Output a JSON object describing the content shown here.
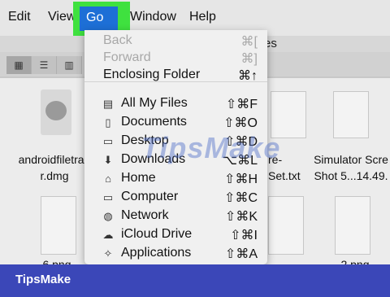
{
  "menubar": {
    "items": [
      "Edit",
      "View",
      "Go",
      "Window",
      "Help"
    ]
  },
  "window": {
    "title_fragment": "es"
  },
  "toolbar": {
    "view_buttons": [
      "icon-view-icon",
      "list-view-icon",
      "column-view-icon"
    ]
  },
  "files": [
    {
      "label_line1": "androidfiletran",
      "label_line2": "r.dmg"
    },
    {
      "label_line1": "re-",
      "label_line2": "Set.txt"
    },
    {
      "label_line1": "Simulator Scre",
      "label_line2": "Shot 5...14.49."
    },
    {
      "label_line1": "6.png",
      "label_line2": ""
    },
    {
      "label_line1": "2.png",
      "label_line2": ""
    }
  ],
  "go_menu": {
    "top_items": [
      {
        "label": "Back",
        "shortcut": "⌘[",
        "enabled": false
      },
      {
        "label": "Forward",
        "shortcut": "⌘]",
        "enabled": false
      },
      {
        "label": "Enclosing Folder",
        "shortcut": "⌘↑",
        "enabled": true
      }
    ],
    "places": [
      {
        "label": "All My Files",
        "shortcut": "⇧⌘F",
        "icon": "all-files-icon"
      },
      {
        "label": "Documents",
        "shortcut": "⇧⌘O",
        "icon": "documents-icon"
      },
      {
        "label": "Desktop",
        "shortcut": "⇧⌘D",
        "icon": "desktop-icon"
      },
      {
        "label": "Downloads",
        "shortcut": "⌥⌘L",
        "icon": "downloads-icon"
      },
      {
        "label": "Home",
        "shortcut": "⇧⌘H",
        "icon": "home-icon"
      },
      {
        "label": "Computer",
        "shortcut": "⇧⌘C",
        "icon": "computer-icon"
      },
      {
        "label": "Network",
        "shortcut": "⇧⌘K",
        "icon": "network-icon"
      },
      {
        "label": "iCloud Drive",
        "shortcut": "⇧⌘I",
        "icon": "cloud-icon"
      },
      {
        "label": "Applications",
        "shortcut": "⇧⌘A",
        "icon": "applications-icon"
      }
    ]
  },
  "watermark": "TipsMake",
  "brand": "TipsMake",
  "colors": {
    "highlight_green": "#3fe13f",
    "selection_blue": "#1d6fd6",
    "brand_band": "#3b47b8"
  }
}
